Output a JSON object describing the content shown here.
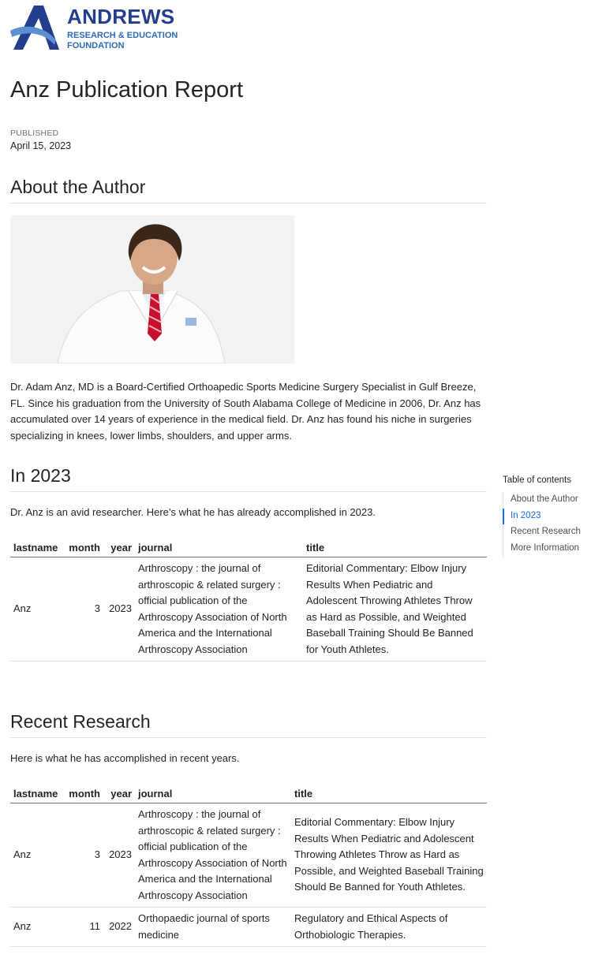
{
  "logo": {
    "name": "ANDREWS",
    "sub_line1": "RESEARCH & EDUCATION",
    "sub_line2": "FOUNDATION",
    "colors": {
      "navy": "#233d8f",
      "blue": "#2d6cb5"
    }
  },
  "page": {
    "title": "Anz Publication Report",
    "published_label": "PUBLISHED",
    "published_date": "April 15, 2023"
  },
  "about": {
    "heading": "About the Author",
    "bio": "Dr. Adam Anz, MD is a Board-Certified Orthoapedic Sports Medicine Surgery Specialist in Gulf Breeze, FL. Since his graduation from the University of South Alabama College of Medicine in 2006, Dr. Anz has accumulated over 14 years of experience in the medical field. Dr. Anz has found his niche in surgeries specializing in knees, lower limbs, shoulders, and upper arms."
  },
  "in2023": {
    "heading": "In 2023",
    "intro": "Dr. Anz is an avid researcher. Here’s what he has already accomplished in 2023.",
    "columns": [
      "lastname",
      "month",
      "year",
      "journal",
      "title"
    ],
    "rows": [
      {
        "lastname": "Anz",
        "month": "3",
        "year": "2023",
        "journal": "Arthroscopy : the journal of arthroscopic & related surgery : official publication of the Arthroscopy Association of North America and the International Arthroscopy Association",
        "title": "Editorial Commentary: Elbow Injury Results When Pediatric and Adolescent Throwing Athletes Throw as Hard as Possible, and Weighted Baseball Training Should Be Banned for Youth Athletes."
      }
    ]
  },
  "recent": {
    "heading": "Recent Research",
    "intro": "Here is what he has accomplished in recent years.",
    "columns": [
      "lastname",
      "month",
      "year",
      "journal",
      "title"
    ],
    "rows": [
      {
        "lastname": "Anz",
        "month": "3",
        "year": "2023",
        "journal": "Arthroscopy : the journal of arthroscopic & related surgery : official publication of the Arthroscopy Association of North America and the International Arthroscopy Association",
        "title": "Editorial Commentary: Elbow Injury Results When Pediatric and Adolescent Throwing Athletes Throw as Hard as Possible, and Weighted Baseball Training Should Be Banned for Youth Athletes."
      },
      {
        "lastname": "Anz",
        "month": "11",
        "year": "2022",
        "journal": "Orthopaedic journal of sports medicine",
        "title": "Regulatory and Ethical Aspects of Orthobiologic Therapies."
      }
    ]
  },
  "toc": {
    "title": "Table of contents",
    "items": [
      {
        "label": "About the Author",
        "active": false
      },
      {
        "label": "In 2023",
        "active": true
      },
      {
        "label": "Recent Research",
        "active": false
      },
      {
        "label": "More Information",
        "active": false
      }
    ]
  }
}
